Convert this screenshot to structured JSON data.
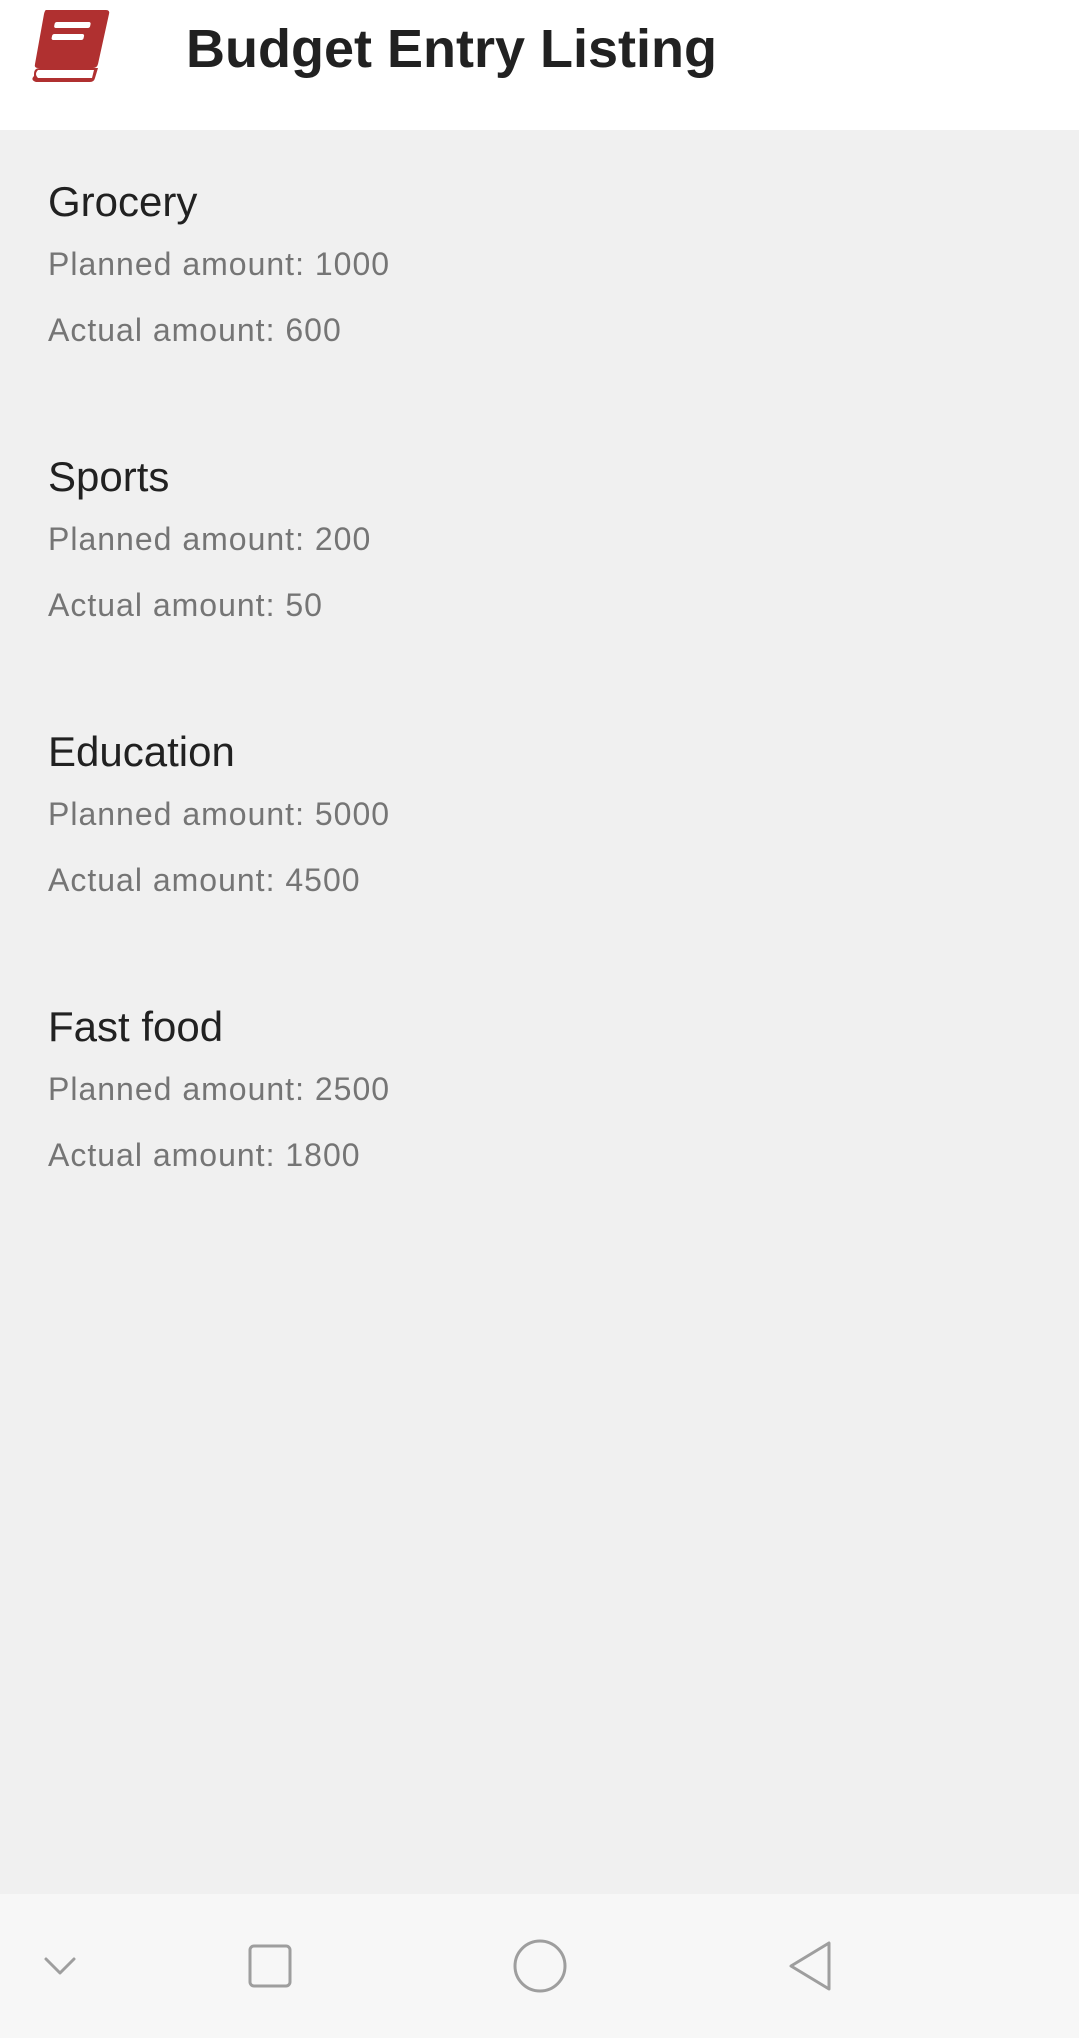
{
  "header": {
    "title": "Budget Entry Listing",
    "icon": "book-icon",
    "icon_color": "#b03030"
  },
  "entries": [
    {
      "name": "Grocery",
      "planned": "Planned amount: 1000",
      "actual": "Actual amount: 600"
    },
    {
      "name": "Sports",
      "planned": "Planned amount: 200",
      "actual": "Actual amount: 50"
    },
    {
      "name": "Education",
      "planned": "Planned amount: 5000",
      "actual": "Actual amount: 4500"
    },
    {
      "name": "Fast food",
      "planned": "Planned amount: 2500",
      "actual": "Actual amount: 1800"
    }
  ],
  "navbar": {
    "buttons": [
      "chevron-down-icon",
      "square-icon",
      "circle-icon",
      "triangle-back-icon"
    ]
  }
}
